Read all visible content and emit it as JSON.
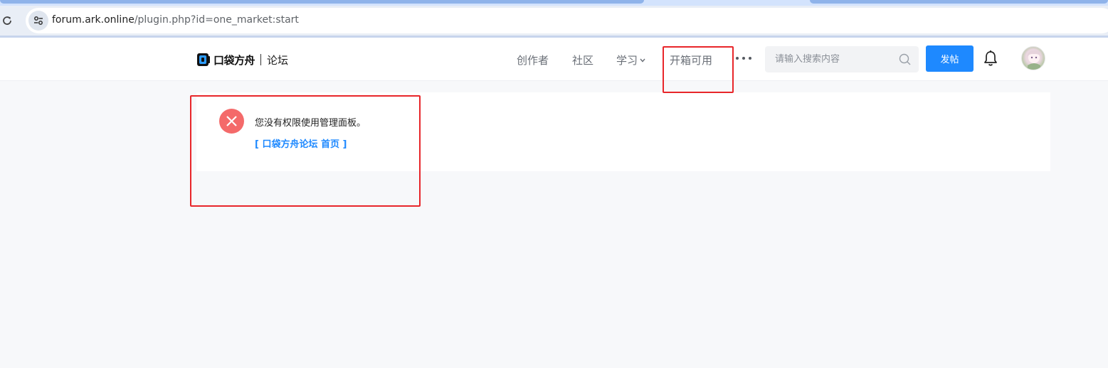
{
  "browser": {
    "url_host": "forum.ark.online",
    "url_path": "/plugin.php?id=one_market:start"
  },
  "header": {
    "logo_brand": "口袋方舟",
    "logo_sub": "论坛",
    "nav": {
      "creator": "创作者",
      "community": "社区",
      "learn": "学习",
      "unbox": "开箱可用"
    },
    "search_placeholder": "请输入搜索内容",
    "post_label": "发帖"
  },
  "main": {
    "error_message": "您没有权限使用管理面板。",
    "home_link": "[ 口袋方舟论坛 首页 ]"
  },
  "colors": {
    "accent": "#1e89ff",
    "error": "#f46a6a",
    "annotation": "#e8262a"
  }
}
